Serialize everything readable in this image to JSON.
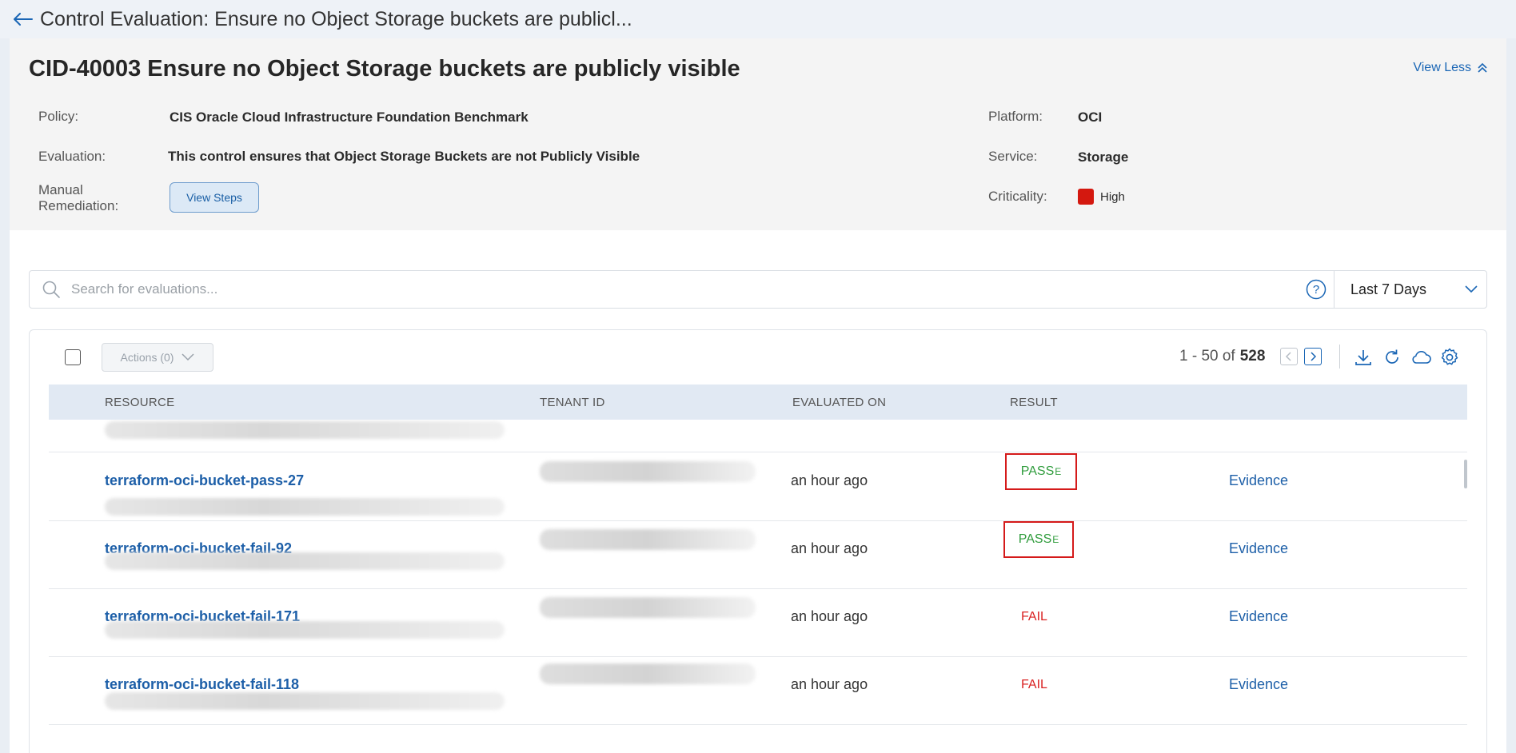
{
  "header": {
    "title": "Control Evaluation: Ensure no Object Storage buckets are publicl..."
  },
  "control": {
    "title": "CID-40003 Ensure no Object Storage buckets are publicly visible",
    "view_less_label": "View Less",
    "policy_label": "Policy:",
    "policy_value": "CIS Oracle Cloud Infrastructure Foundation Benchmark",
    "evaluation_label": "Evaluation:",
    "evaluation_value": "This control ensures that Object Storage Buckets are not Publicly Visible",
    "manual_remediation_label_line1": "Manual",
    "manual_remediation_label_line2": "Remediation:",
    "view_steps_label": "View Steps",
    "platform_label": "Platform:",
    "platform_value": "OCI",
    "service_label": "Service:",
    "service_value": "Storage",
    "criticality_label": "Criticality:",
    "criticality_value": "High",
    "criticality_color": "#d4180f"
  },
  "search": {
    "placeholder": "Search for evaluations...",
    "date_range": "Last 7 Days"
  },
  "toolbar": {
    "actions_label": "Actions (0)",
    "range": "1 - 50 of",
    "total": "528"
  },
  "table": {
    "columns": [
      "RESOURCE",
      "TENANT ID",
      "EVALUATED ON",
      "RESULT"
    ],
    "rows": [
      {
        "resource": "terraform-oci-bucket-pass-27",
        "evaluated": "an hour ago",
        "result": "PASS",
        "result_sup": "E",
        "evidence": "Evidence"
      },
      {
        "resource": "terraform-oci-bucket-fail-92",
        "evaluated": "an hour ago",
        "result": "PASS",
        "result_sup": "E",
        "evidence": "Evidence"
      },
      {
        "resource": "terraform-oci-bucket-fail-171",
        "evaluated": "an hour ago",
        "result": "FAIL",
        "evidence": "Evidence"
      },
      {
        "resource": "terraform-oci-bucket-fail-118",
        "evaluated": "an hour ago",
        "result": "FAIL",
        "evidence": "Evidence"
      }
    ]
  },
  "colors": {
    "link": "#1d5fa8",
    "pass": "#2f9c3c",
    "fail": "#d91f1f",
    "highlight_box": "#d51a1a",
    "header_bg": "#e1e9f3"
  }
}
